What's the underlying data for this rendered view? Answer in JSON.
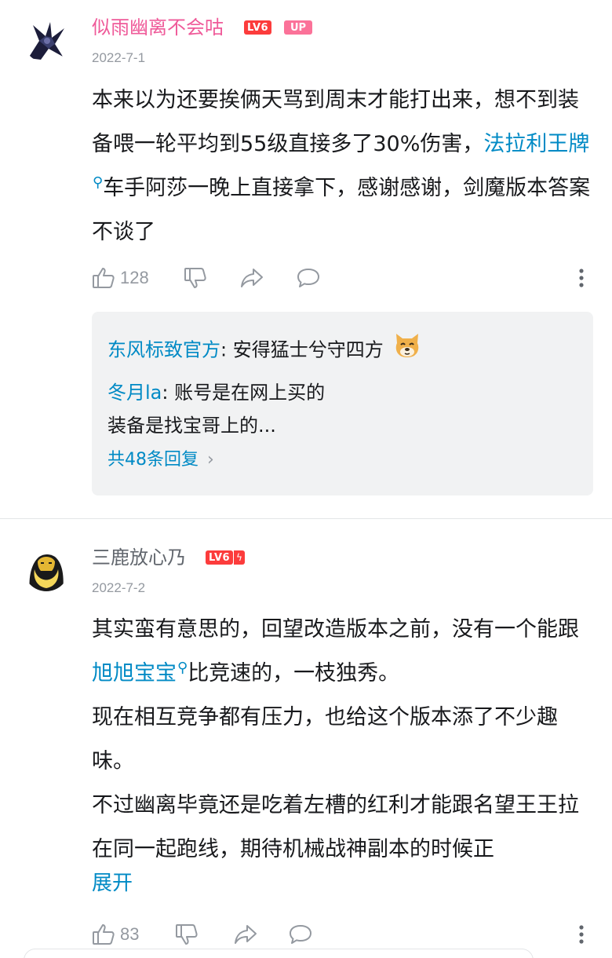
{
  "comments": [
    {
      "username": "似雨幽离不会咕",
      "level": "LV6",
      "badge": "UP",
      "date": "2022-7-1",
      "text_parts": {
        "p1": "本来以为还要挨俩天骂到周末才能打出来，想不到装备喂一轮平均到55级直接多了30%伤害，",
        "link": "法拉利王牌",
        "p2": "车手阿莎一晚上直接拿下，感谢感谢，剑魔版本答案不谈了"
      },
      "likes": "128",
      "replies": [
        {
          "name": "东风标致官方",
          "text": "安得猛士兮守四方"
        },
        {
          "name": "冬月la",
          "line1": "账号是在网上买的",
          "line2": "装备是找宝哥上的..."
        }
      ],
      "more_replies": "共48条回复"
    },
    {
      "username": "三鹿放心乃",
      "level": "LV6",
      "date": "2022-7-2",
      "text_parts": {
        "p1": "其实蛮有意思的，回望改造版本之前，没有一个能跟",
        "link": "旭旭宝宝",
        "p2": "比竞速的，一枝独秀。",
        "p3": "现在相互竞争都有压力，也给这个版本添了不少趣味。",
        "p4": "不过幽离毕竟还是吃着左槽的红利才能跟名望王王拉在同一起跑线，期待机械战神副本的时候正"
      },
      "expand_label": "展开",
      "likes": "83"
    }
  ],
  "icons": {
    "like": "thumbs-up-icon",
    "dislike": "thumbs-down-icon",
    "share": "share-icon",
    "reply": "comment-bubble-icon",
    "more": "more-vertical-icon",
    "search_hint": "search-magnifier-icon"
  },
  "colors": {
    "link": "#008ac5",
    "vip_name": "#ef5a99",
    "level_badge": "#fc3c3c",
    "up_badge": "#fb7299"
  }
}
